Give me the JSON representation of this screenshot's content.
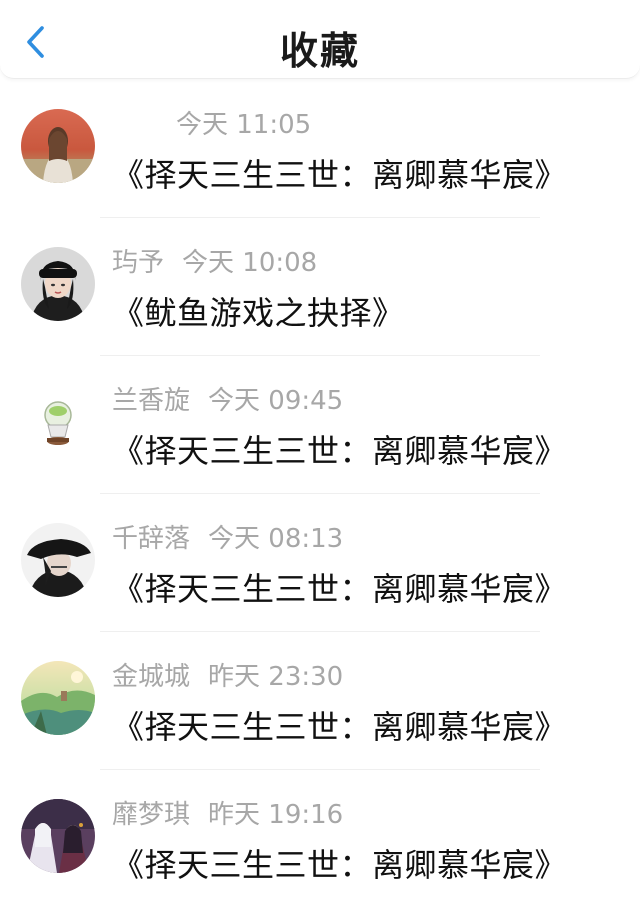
{
  "header": {
    "back_icon": "chevron-left-icon",
    "title": "收藏",
    "accent_color": "#2f8ee0"
  },
  "items": [
    {
      "name": "",
      "time": "今天 11:05",
      "content": "《择天三生三世：离卿慕华宸》",
      "avatar": "girl-field-avatar"
    },
    {
      "name": "玙予",
      "time": "今天 10:08",
      "content": "《鱿鱼游戏之抉择》",
      "avatar": "girl-cap-avatar"
    },
    {
      "name": "兰香旋",
      "time": "今天 09:45",
      "content": "《择天三生三世：离卿慕华宸》",
      "avatar": "crystal-ball-avatar"
    },
    {
      "name": "千辞落",
      "time": "今天 08:13",
      "content": "《择天三生三世：离卿慕华宸》",
      "avatar": "hat-person-avatar"
    },
    {
      "name": "金城城",
      "time": "昨天 23:30",
      "content": "《择天三生三世：离卿慕华宸》",
      "avatar": "landscape-avatar"
    },
    {
      "name": "靡梦琪",
      "time": "昨天 19:16",
      "content": "《择天三生三世：离卿慕华宸》",
      "avatar": "anime-couple-avatar"
    }
  ]
}
